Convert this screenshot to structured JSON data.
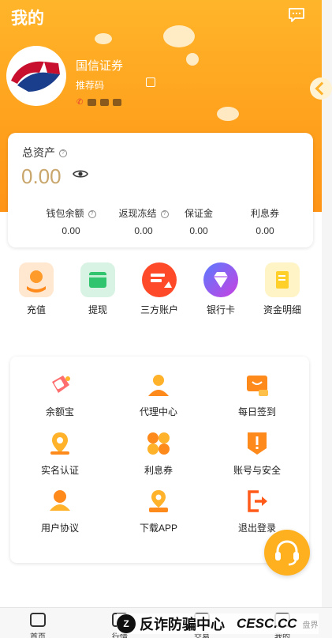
{
  "header": {
    "title": "我的"
  },
  "profile": {
    "name": "国信证券",
    "referral_label": "推荐码"
  },
  "assets": {
    "total_label": "总资产",
    "total_value": "0.00",
    "stats": [
      {
        "label": "钱包余额",
        "value": "0.00"
      },
      {
        "label": "返现冻结",
        "value": "0.00"
      },
      {
        "label": "保证金",
        "value": "0.00"
      },
      {
        "label": "利息券",
        "value": "0.00"
      }
    ]
  },
  "quick_actions": [
    {
      "label": "充值",
      "icon": "recharge-icon",
      "color": "#ffe7d0"
    },
    {
      "label": "提现",
      "icon": "withdraw-icon",
      "color": "#d8f3e3"
    },
    {
      "label": "三方账户",
      "icon": "third-party-account-icon",
      "color": "#ff4a2a"
    },
    {
      "label": "银行卡",
      "icon": "bank-card-icon",
      "color": "#8a4fff"
    },
    {
      "label": "资金明细",
      "icon": "fund-details-icon",
      "color": "#fff4c6"
    }
  ],
  "services": [
    {
      "label": "余额宝",
      "icon": "yuebao-icon"
    },
    {
      "label": "代理中心",
      "icon": "agent-center-icon"
    },
    {
      "label": "每日签到",
      "icon": "daily-checkin-icon"
    },
    {
      "label": "实名认证",
      "icon": "real-name-auth-icon"
    },
    {
      "label": "利息券",
      "icon": "interest-coupon-icon"
    },
    {
      "label": "账号与安全",
      "icon": "account-security-icon"
    },
    {
      "label": "用户协议",
      "icon": "user-agreement-icon"
    },
    {
      "label": "下载APP",
      "icon": "download-app-icon"
    },
    {
      "label": "退出登录",
      "icon": "logout-icon"
    }
  ],
  "bottom_nav": [
    {
      "label": "首页",
      "icon": "home-icon"
    },
    {
      "label": "行情",
      "icon": "market-icon"
    },
    {
      "label": "交易",
      "icon": "trade-icon"
    },
    {
      "label": "我的",
      "icon": "profile-icon"
    }
  ],
  "watermark": {
    "text": "反诈防骗中心",
    "brand": "CESC.CC",
    "extra": "盘界"
  }
}
